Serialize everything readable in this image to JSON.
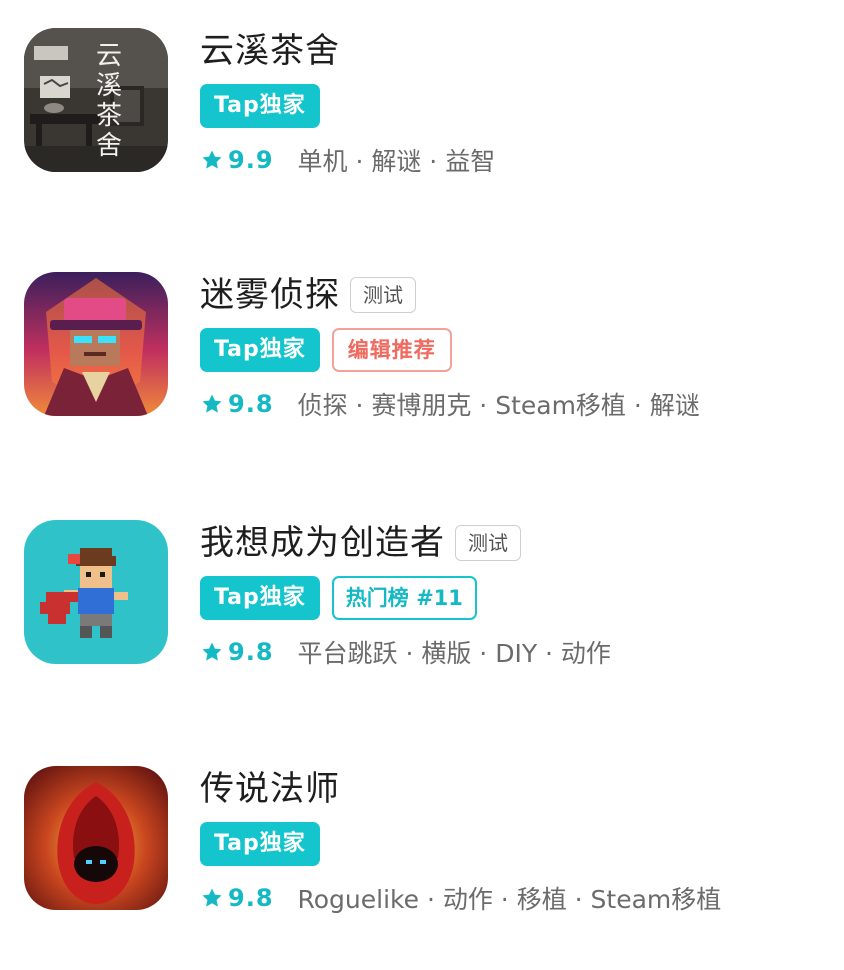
{
  "colors": {
    "accent": "#15c5ce",
    "editor_red": "#ef6a5f",
    "text_primary": "#1e1e1e",
    "text_secondary": "#6b6b6b"
  },
  "games": [
    {
      "title": "云溪茶舍",
      "test_badge": "",
      "tap_badge": "Tap独家",
      "extra_badge": "",
      "rating": "9.9",
      "tags": "单机 · 解谜 · 益智",
      "icon": "yunxi-teahouse-icon",
      "icon_text": "云溪茶舍"
    },
    {
      "title": "迷雾侦探",
      "test_badge": "测试",
      "tap_badge": "Tap独家",
      "extra_badge": "编辑推荐",
      "rating": "9.8",
      "tags": "侦探 · 赛博朋克 · Steam移植 · 解谜",
      "icon": "detective-icon"
    },
    {
      "title": "我想成为创造者",
      "test_badge": "测试",
      "tap_badge": "Tap独家",
      "extra_badge": "热门榜 #11",
      "rating": "9.8",
      "tags": "平台跳跃 · 横版 · DIY · 动作",
      "icon": "pixel-hero-icon"
    },
    {
      "title": "传说法师",
      "test_badge": "",
      "tap_badge": "Tap独家",
      "extra_badge": "",
      "rating": "9.8",
      "tags": "Roguelike · 动作 · 移植 · Steam移植",
      "icon": "red-mage-icon"
    }
  ]
}
